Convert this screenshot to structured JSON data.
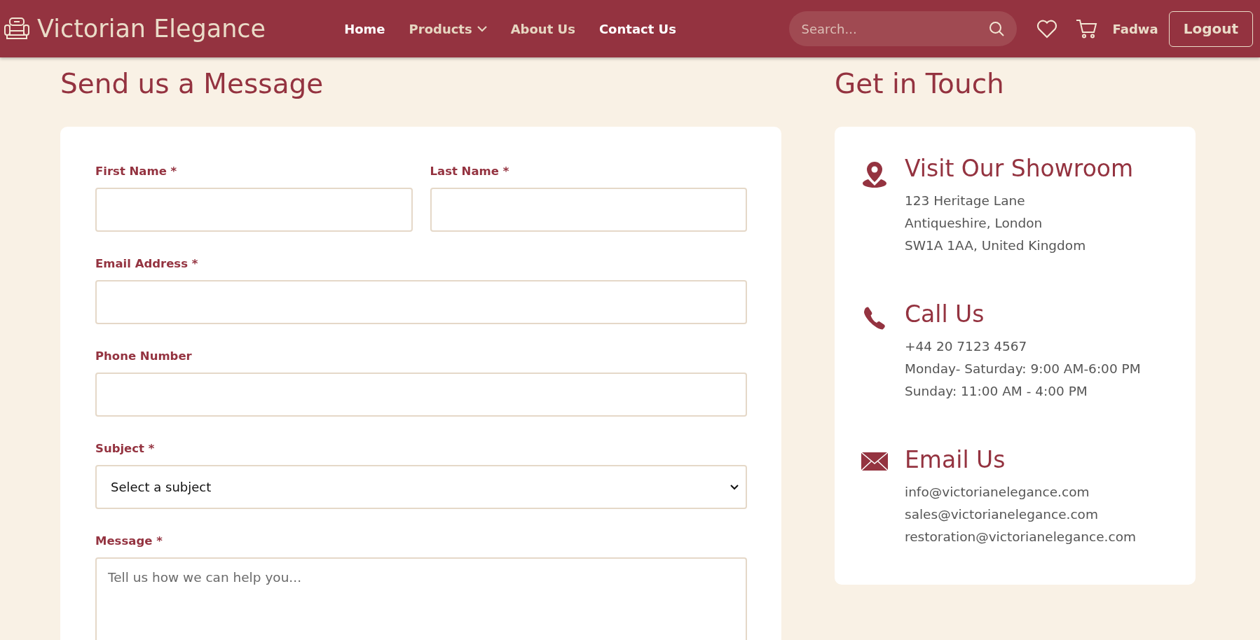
{
  "header": {
    "brand": "Victorian Elegance",
    "nav": [
      {
        "label": "Home",
        "active": true,
        "has_menu": false
      },
      {
        "label": "Products",
        "active": false,
        "has_menu": true
      },
      {
        "label": "About Us",
        "active": false,
        "has_menu": false
      },
      {
        "label": "Contact Us",
        "active": true,
        "has_menu": false
      }
    ],
    "search": {
      "placeholder": "Search..."
    },
    "user": "Fadwa",
    "logout": "Logout"
  },
  "form": {
    "title": "Send us a Message",
    "rows": [
      [
        {
          "kind": "input",
          "label": "First Name *"
        },
        {
          "kind": "input",
          "label": "Last Name *"
        }
      ],
      [
        {
          "kind": "input",
          "label": "Email Address *"
        }
      ],
      [
        {
          "kind": "input",
          "label": "Phone Number"
        }
      ],
      [
        {
          "kind": "select",
          "label": "Subject *",
          "value": "Select a subject"
        }
      ],
      [
        {
          "kind": "textarea",
          "label": "Message *",
          "placeholder": "Tell us how we can help you..."
        }
      ]
    ]
  },
  "contact": {
    "title": "Get in Touch",
    "sections": [
      {
        "kind": "location",
        "heading": "Visit Our Showroom",
        "lines": [
          "123 Heritage Lane",
          "Antiqueshire, London",
          "SW1A 1AA, United Kingdom"
        ]
      },
      {
        "kind": "phone",
        "heading": "Call Us",
        "lines": [
          "+44 20 7123 4567",
          "Monday- Saturday: 9:00 AM-6:00 PM",
          "Sunday: 11:00 AM - 4:00 PM"
        ]
      },
      {
        "kind": "email",
        "heading": "Email Us",
        "lines": [
          "info@victorianelegance.com",
          "sales@victorianelegance.com",
          "restoration@victorianelegance.com"
        ]
      }
    ]
  }
}
